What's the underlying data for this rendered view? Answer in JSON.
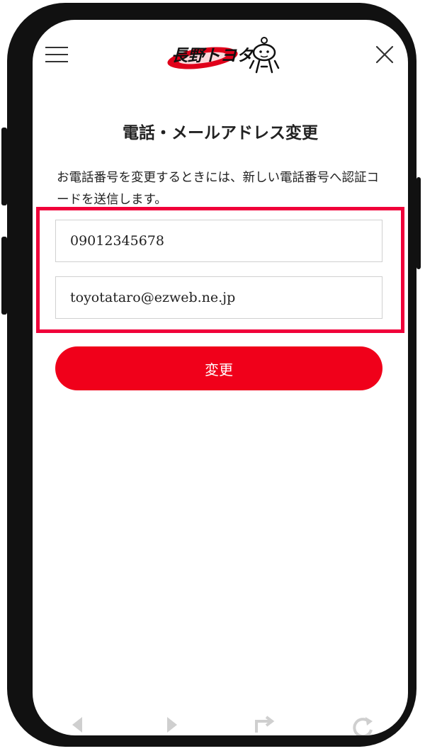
{
  "logo": {
    "text": "長野トヨタ"
  },
  "page": {
    "title": "電話・メールアドレス変更",
    "description": "お電話番号を変更するときには、新しい電話番号へ認証コードを送信します。"
  },
  "form": {
    "phone_value": "09012345678",
    "email_value": "toyotataro@ezweb.ne.jp",
    "submit_label": "変更"
  },
  "colors": {
    "accent": "#f0001a",
    "highlight": "#f0003a"
  },
  "icons": [
    "menu-icon",
    "close-icon",
    "mascot-icon",
    "back-icon",
    "forward-icon",
    "share-icon",
    "refresh-icon"
  ]
}
